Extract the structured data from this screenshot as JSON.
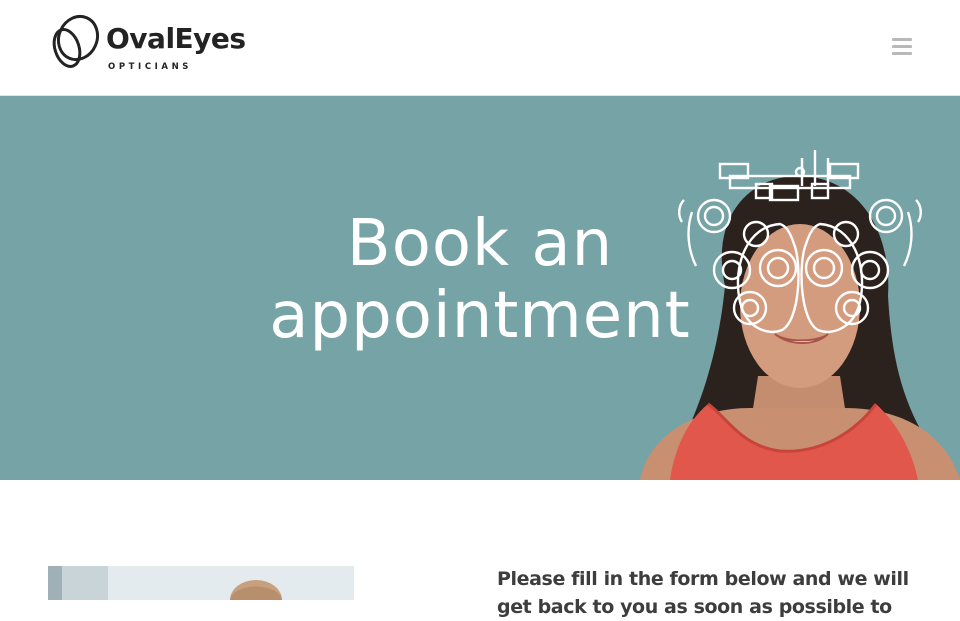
{
  "header": {
    "logo": {
      "name": "OvalEyes",
      "tagline": "OPTICIANS"
    },
    "menu_icon": "hamburger-menu-icon"
  },
  "hero": {
    "title_line1": "Book an",
    "title_line2": "appointment",
    "background_color": "#76a3a6",
    "accent_color": "#e95050"
  },
  "content": {
    "intro_text": "Please fill in the form below and we will get back to you as soon as possible to"
  }
}
